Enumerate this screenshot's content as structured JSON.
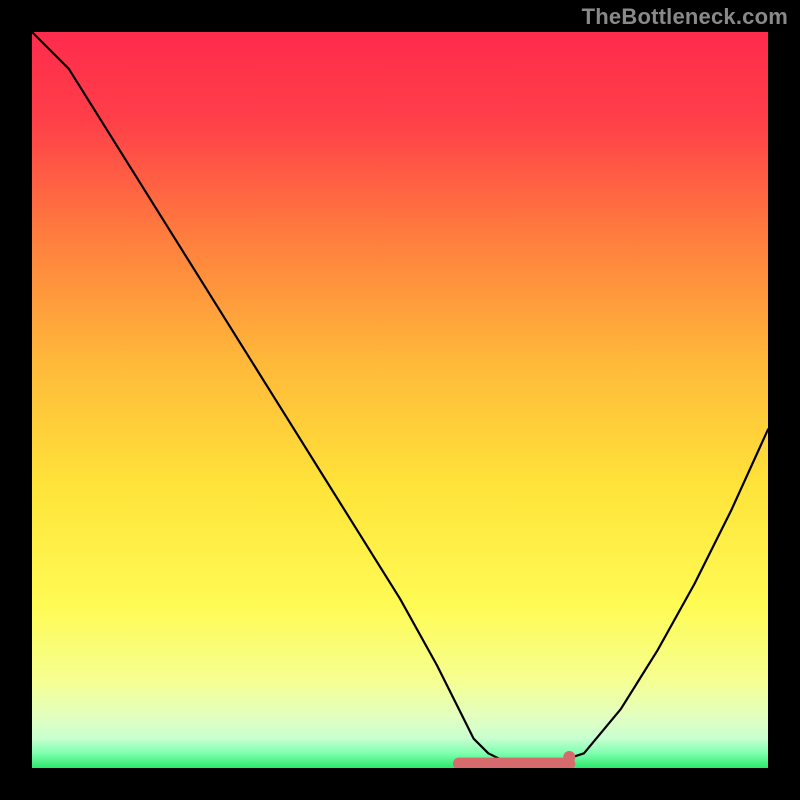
{
  "watermark": "TheBottleneck.com",
  "colors": {
    "top": "#ff2b4c",
    "mid_upper": "#ff8a3a",
    "mid": "#ffd23a",
    "mid_lower": "#fff94c",
    "pale": "#eaffb8",
    "green": "#2be86a",
    "curve": "#000000",
    "marker": "#d66a6d"
  },
  "chart_data": {
    "type": "line",
    "title": "",
    "xlabel": "",
    "ylabel": "",
    "xlim": [
      0,
      100
    ],
    "ylim": [
      0,
      100
    ],
    "x": [
      0,
      5,
      10,
      15,
      20,
      25,
      30,
      35,
      40,
      45,
      50,
      55,
      58,
      60,
      62,
      65,
      68,
      70,
      72,
      75,
      80,
      85,
      90,
      95,
      100
    ],
    "values": [
      100,
      95,
      87,
      79,
      71,
      63,
      55,
      47,
      39,
      31,
      23,
      14,
      8,
      4,
      2,
      0.5,
      0.5,
      0.5,
      1,
      2,
      8,
      16,
      25,
      35,
      46
    ],
    "annotations": {
      "flat_segment_x": [
        58,
        73
      ],
      "marker_x": 73
    }
  }
}
